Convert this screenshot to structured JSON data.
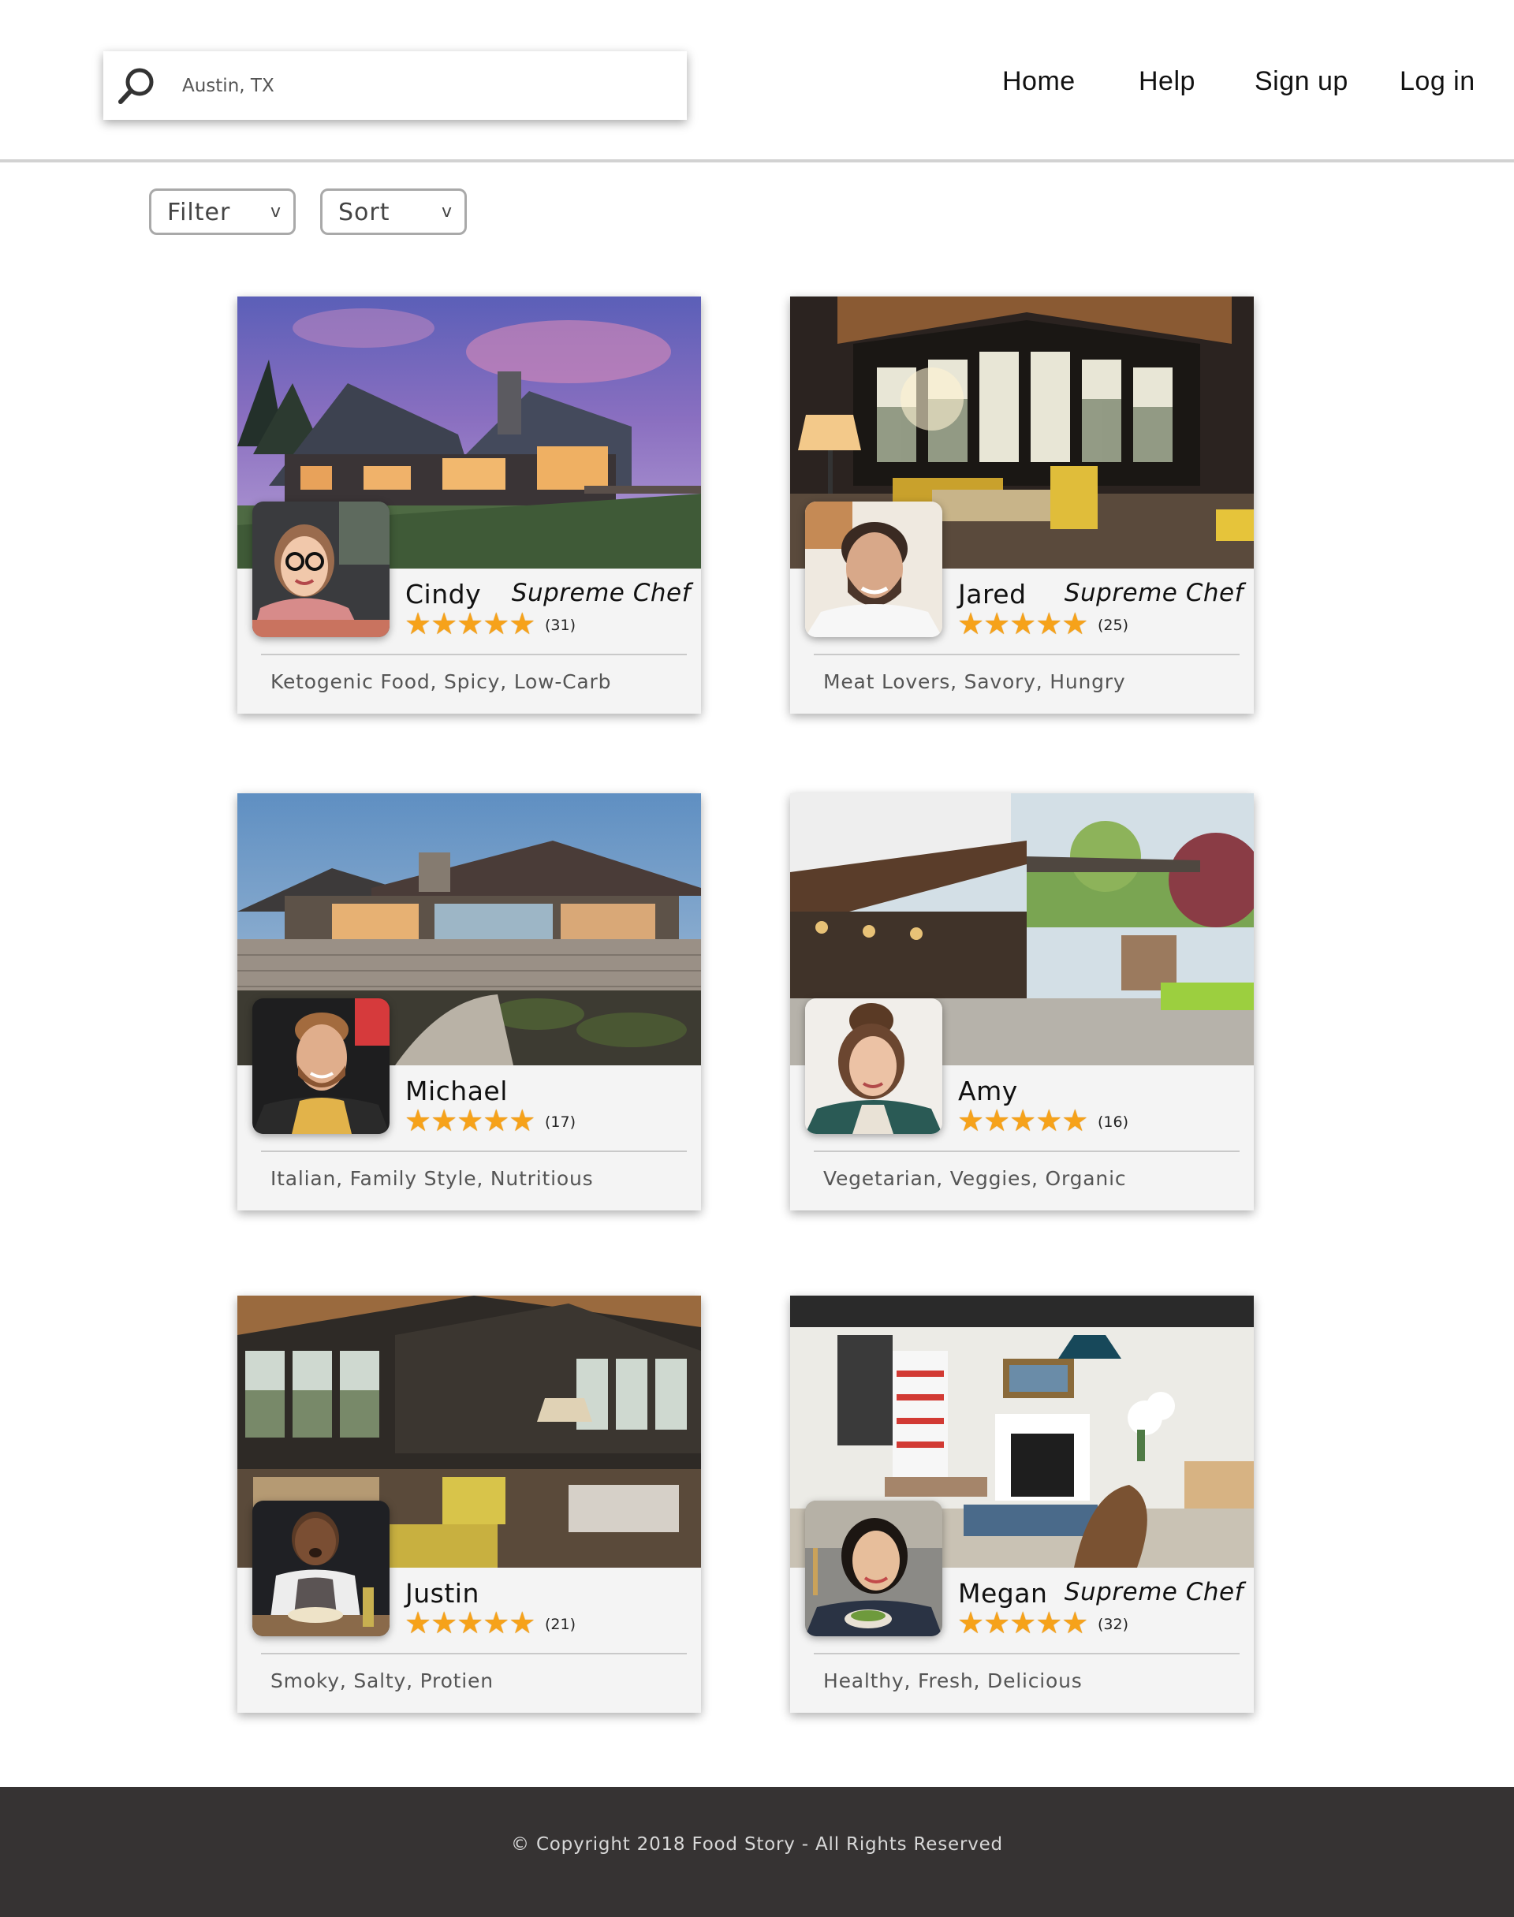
{
  "header": {
    "search": {
      "value": "Austin, TX"
    },
    "nav": [
      "Home",
      "Help",
      "Sign up",
      "Log in"
    ]
  },
  "controls": {
    "filter_label": "Filter",
    "sort_label": "Sort",
    "chevron": "v"
  },
  "chefs": [
    {
      "name": "Cindy",
      "badge": "Supreme Chef",
      "rating": 5,
      "reviews": "(31)",
      "tags": "Ketogenic Food, Spicy, Low-Carb",
      "photo": "dusk-mountain-lodge",
      "avatar": "woman-glasses"
    },
    {
      "name": "Jared",
      "badge": "Supreme Chef",
      "rating": 5,
      "reviews": "(25)",
      "tags": "Meat Lovers, Savory, Hungry",
      "photo": "timber-living-room",
      "avatar": "bearded-man"
    },
    {
      "name": "Michael",
      "badge": "",
      "rating": 5,
      "reviews": "(17)",
      "tags": "Italian, Family Style, Nutritious",
      "photo": "stone-modern-house",
      "avatar": "man-apron"
    },
    {
      "name": "Amy",
      "badge": "",
      "rating": 5,
      "reviews": "(16)",
      "tags": "Vegetarian, Veggies, Organic",
      "photo": "covered-patio",
      "avatar": "woman-curly"
    },
    {
      "name": "Justin",
      "badge": "",
      "rating": 5,
      "reviews": "(21)",
      "tags": "Smoky, Salty, Protien",
      "photo": "vaulted-great-room",
      "avatar": "man-dough"
    },
    {
      "name": "Megan",
      "badge": "Supreme Chef",
      "rating": 5,
      "reviews": "(32)",
      "tags": "Healthy, Fresh, Delicious",
      "photo": "bright-dining-room",
      "avatar": "woman-salad"
    }
  ],
  "footer": {
    "copyright": "© Copyright 2018 Food Story - All Rights Reserved"
  }
}
